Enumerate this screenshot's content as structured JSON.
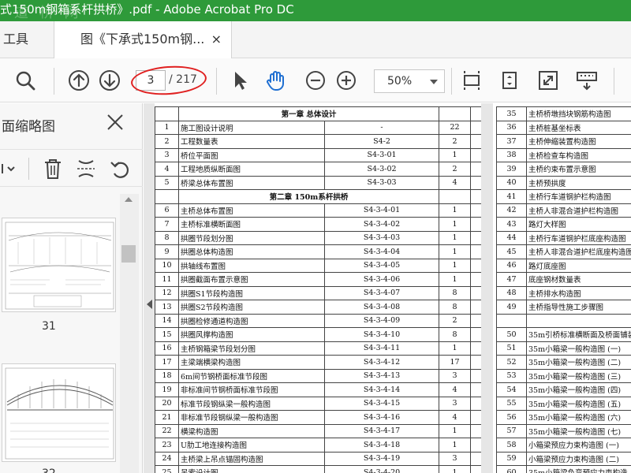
{
  "window": {
    "title": "式150m钢箱系杆拱桥》.pdf - Adobe Acrobat Pro DC",
    "watermark": "道 桥 网"
  },
  "tabs": {
    "tools_label": "工具",
    "doc_label": "图《下承式150m钢...",
    "close_glyph": "×"
  },
  "toolbar": {
    "current_page": "3",
    "total_pages": "/ 217",
    "zoom": "50%",
    "icons": [
      "search-icon",
      "page-up-icon",
      "page-down-icon",
      "select-arrow-icon",
      "hand-tool-icon",
      "zoom-out-icon",
      "zoom-in-icon",
      "fit-page-icon",
      "scroll-mode-icon",
      "full-screen-icon",
      "keyboard-icon"
    ],
    "highlight_color": "#e02020"
  },
  "panel": {
    "title": "面缩略图",
    "thumbnails": [
      {
        "label": "31"
      },
      {
        "label": "32"
      }
    ]
  },
  "document": {
    "left_table": {
      "chapter1": "第一章 总体设计",
      "chapter2": "第二章 150m系杆拱桥",
      "rows_a": [
        {
          "no": "1",
          "name": "施工图设计说明",
          "code": "-",
          "sheets": "22"
        },
        {
          "no": "2",
          "name": "工程数量表",
          "code": "S4-2",
          "sheets": "2"
        },
        {
          "no": "3",
          "name": "桥位平面图",
          "code": "S4-3-01",
          "sheets": "1"
        },
        {
          "no": "4",
          "name": "工程地质纵断面图",
          "code": "S4-3-02",
          "sheets": "2"
        },
        {
          "no": "5",
          "name": "桥梁总体布置图",
          "code": "S4-3-03",
          "sheets": "4"
        }
      ],
      "rows_b": [
        {
          "no": "6",
          "name": "主桥总体布置图",
          "code": "S4-3-4-01",
          "sheets": "1"
        },
        {
          "no": "7",
          "name": "主桥标准横断面图",
          "code": "S4-3-4-02",
          "sheets": "1"
        },
        {
          "no": "8",
          "name": "拱圈节段划分图",
          "code": "S4-3-4-03",
          "sheets": "1"
        },
        {
          "no": "9",
          "name": "拱圈总体构造图",
          "code": "S4-3-4-04",
          "sheets": "1"
        },
        {
          "no": "10",
          "name": "拱轴线布置图",
          "code": "S4-3-4-05",
          "sheets": "1"
        },
        {
          "no": "11",
          "name": "拱圈截面布置示意图",
          "code": "S4-3-4-06",
          "sheets": "1"
        },
        {
          "no": "12",
          "name": "拱圈S1节段构造图",
          "code": "S4-3-4-07",
          "sheets": "8"
        },
        {
          "no": "13",
          "name": "拱圈S2节段构造图",
          "code": "S4-3-4-08",
          "sheets": "8"
        },
        {
          "no": "14",
          "name": "拱圈检修通道构造图",
          "code": "S4-3-4-09",
          "sheets": "2"
        },
        {
          "no": "15",
          "name": "拱圈风撑构造图",
          "code": "S4-3-4-10",
          "sheets": "8"
        },
        {
          "no": "16",
          "name": "主桥钢箱梁节段划分图",
          "code": "S4-3-4-11",
          "sheets": "1"
        },
        {
          "no": "17",
          "name": "主梁端横梁构造图",
          "code": "S4-3-4-12",
          "sheets": "17"
        },
        {
          "no": "18",
          "name": "6m间节钢桥面标准节段图",
          "code": "S4-3-4-13",
          "sheets": "3"
        },
        {
          "no": "19",
          "name": "非标准间节钢桥面标准节段图",
          "code": "S4-3-4-14",
          "sheets": "4"
        },
        {
          "no": "20",
          "name": "标准节段钢纵梁一般构造图",
          "code": "S4-3-4-15",
          "sheets": "3"
        },
        {
          "no": "21",
          "name": "非标准节段钢纵梁一般构造图",
          "code": "S4-3-4-16",
          "sheets": "4"
        },
        {
          "no": "22",
          "name": "横梁构造图",
          "code": "S4-3-4-17",
          "sheets": "1"
        },
        {
          "no": "23",
          "name": "U肋工地连接构造图",
          "code": "S4-3-4-18",
          "sheets": "1"
        },
        {
          "no": "24",
          "name": "主桥梁上吊点锚固构造图",
          "code": "S4-3-4-19",
          "sheets": "3"
        },
        {
          "no": "25",
          "name": "吊索设计图",
          "code": "S4-3-4-20",
          "sheets": "1"
        }
      ]
    },
    "right_table": {
      "rows_a": [
        {
          "no": "35",
          "name": "主桥桥墩挡块钢筋构造图"
        },
        {
          "no": "36",
          "name": "主桥桩基坐标表"
        },
        {
          "no": "37",
          "name": "主桥伸缩装置构造图"
        },
        {
          "no": "38",
          "name": "主桥检查车构造图"
        },
        {
          "no": "39",
          "name": "主桥约束布置示意图"
        },
        {
          "no": "40",
          "name": "主桥预拱度"
        },
        {
          "no": "41",
          "name": "主桥行车道钢护栏构造图"
        },
        {
          "no": "42",
          "name": "主桥人非混合道护栏构造图"
        },
        {
          "no": "43",
          "name": "路灯大样图"
        },
        {
          "no": "44",
          "name": "主桥行车道钢护栏底座构造图"
        },
        {
          "no": "45",
          "name": "主桥人非混合道护栏底座构造图"
        },
        {
          "no": "46",
          "name": "路灯底座图"
        },
        {
          "no": "47",
          "name": "底座钢材数量表"
        },
        {
          "no": "48",
          "name": "主桥排水构造图"
        },
        {
          "no": "49",
          "name": "主桥指导性施工步骤图"
        }
      ],
      "chapter_fragment": "第三",
      "rows_b": [
        {
          "no": "50",
          "name": "35m引桥标准横断面及桥面铺装"
        },
        {
          "no": "51",
          "name": "35m小箱梁一般构造图 (一)"
        },
        {
          "no": "52",
          "name": "35m小箱梁一般构造图 (二)"
        },
        {
          "no": "53",
          "name": "35m小箱梁一般构造图 (三)"
        },
        {
          "no": "54",
          "name": "35m小箱梁一般构造图 (四)"
        },
        {
          "no": "55",
          "name": "35m小箱梁一般构造图 (五)"
        },
        {
          "no": "56",
          "name": "35m小箱梁一般构造图 (六)"
        },
        {
          "no": "57",
          "name": "35m小箱梁一般构造图 (七)"
        },
        {
          "no": "58",
          "name": "小箱梁预应力束构造图 (一)"
        },
        {
          "no": "59",
          "name": "小箱梁预应力束构造图 (二)"
        },
        {
          "no": "60",
          "name": "35m小箱梁负弯预应力束构造"
        }
      ]
    }
  }
}
